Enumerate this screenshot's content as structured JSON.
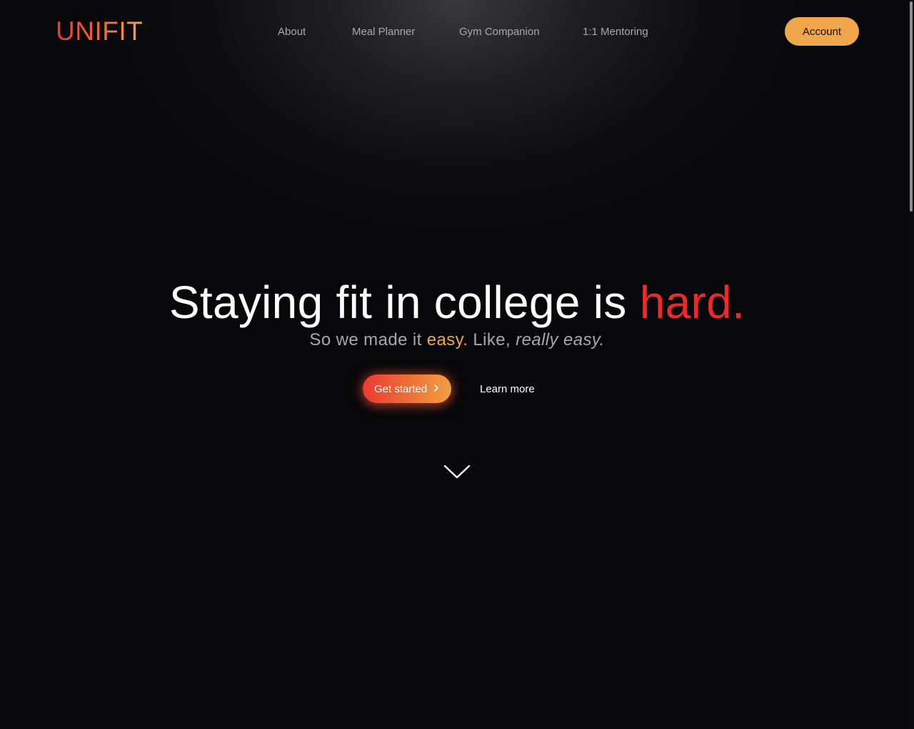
{
  "brand": {
    "logo_text": "UNIFIT"
  },
  "nav": {
    "items": [
      {
        "label": "About"
      },
      {
        "label": "Meal Planner"
      },
      {
        "label": "Gym Companion"
      },
      {
        "label": "1:1 Mentoring"
      }
    ],
    "account_label": "Account"
  },
  "hero": {
    "headline_main": "Staying fit in college is ",
    "headline_accent": "hard.",
    "subhead_part1": "So we made it ",
    "subhead_accent": "easy.",
    "subhead_part2": " Like, ",
    "subhead_italic": "really easy."
  },
  "cta": {
    "primary_label": "Get started",
    "secondary_label": "Learn more"
  },
  "icons": {
    "primary_chevron": "chevron-right-icon",
    "scroll": "chevron-down-icon"
  },
  "colors": {
    "background": "#07080b",
    "brand_red": "#ec2a2a",
    "brand_orange": "#f0a64a",
    "nav_text": "#a7a9ad"
  }
}
